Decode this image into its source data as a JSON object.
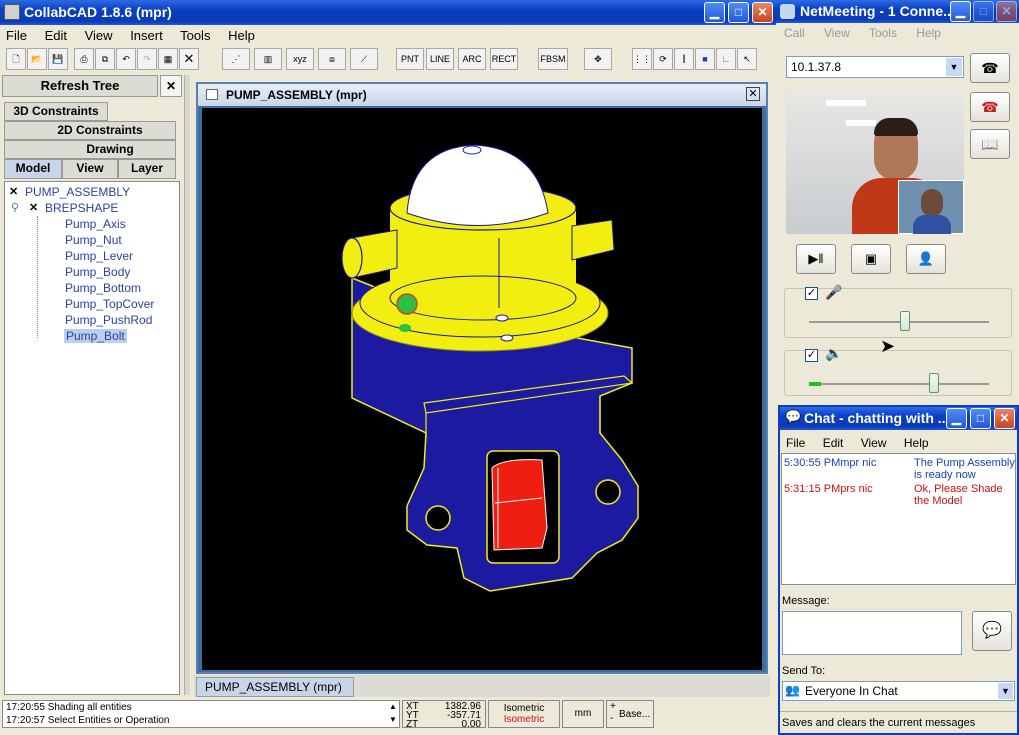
{
  "collabcad": {
    "title": "CollabCAD 1.8.6 (mpr)",
    "menu": [
      "File",
      "Edit",
      "View",
      "Insert",
      "Tools",
      "Help"
    ],
    "toolbar_groups": [
      "PNT",
      "LINE",
      "ARC",
      "RECT",
      "FBSM"
    ],
    "left_panel": {
      "refresh_label": "Refresh Tree",
      "tabs_row1": "3D Constraints",
      "tabs_row2": "2D Constraints",
      "tabs_row3": "Drawing",
      "tabs_row4": [
        "Model",
        "View",
        "Layer"
      ],
      "tree": {
        "root": "PUMP_ASSEMBLY",
        "child": "BREPSHAPE",
        "items": [
          "Pump_Axis",
          "Pump_Nut",
          "Pump_Lever",
          "Pump_Body",
          "Pump_Bottom",
          "Pump_TopCover",
          "Pump_PushRod",
          "Pump_Bolt"
        ],
        "selected": "Pump_Bolt"
      }
    },
    "viewport": {
      "title": "PUMP_ASSEMBLY (mpr)",
      "bottom_tab": "PUMP_ASSEMBLY (mpr)"
    },
    "status": {
      "log": [
        "17:20:55 Shading all entities",
        "17:20:57 Select Entities or Operation"
      ],
      "coords": [
        {
          "axis": "XT",
          "value": "1382.96"
        },
        {
          "axis": "YT",
          "value": "-357.71"
        },
        {
          "axis": "ZT",
          "value": "0.00"
        }
      ],
      "view1": "Isometric",
      "view2": "Isometric",
      "units": "mm",
      "base": "Base..."
    }
  },
  "netmeeting": {
    "title": "NetMeeting - 1 Conne...",
    "menu": [
      "Call",
      "View",
      "Tools",
      "Help"
    ],
    "address": "10.1.37.8",
    "mic_level": 0.6,
    "speaker_level": 0.7
  },
  "chat": {
    "title": "Chat - chatting with ...",
    "menu": [
      "File",
      "Edit",
      "View",
      "Help"
    ],
    "messages": [
      {
        "time": "5:30:55 PM",
        "from": "mpr nic",
        "text1": "The Pump Assembly",
        "text2": "is ready now",
        "color": "#1a3fc0"
      },
      {
        "time": "5:31:15 PM",
        "from": "prs nic",
        "text1": "Ok,  Please Shade",
        "text2": "the Model",
        "color": "#d01010"
      }
    ],
    "message_label": "Message:",
    "send_to_label": "Send To:",
    "send_to_value": "Everyone In Chat",
    "status": "Saves and clears the current messages"
  },
  "colors": {
    "xp_blue": "#0a3fc4",
    "pump_yellow": "#f2ee10",
    "pump_blue": "#1b1aa0",
    "pump_red": "#f01e10"
  }
}
